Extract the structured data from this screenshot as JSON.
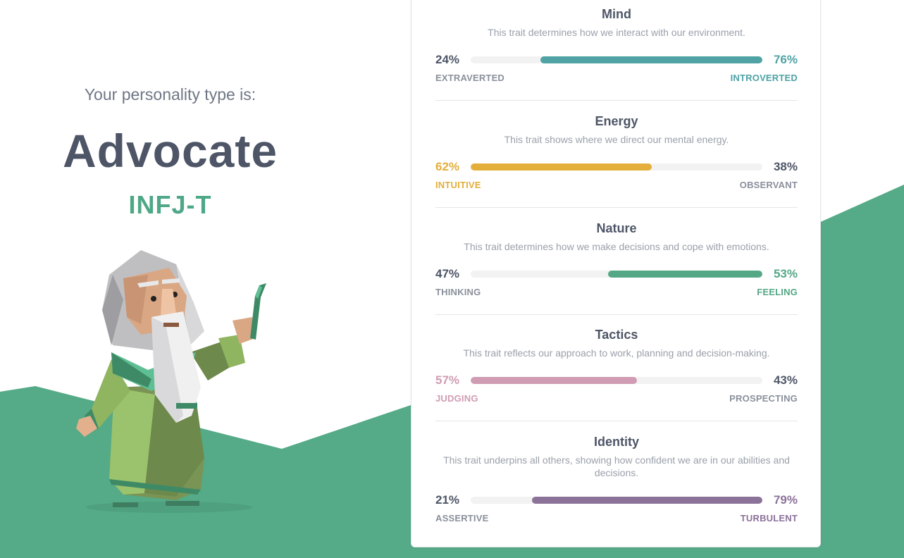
{
  "colors": {
    "background_wave": "#55aa87",
    "text_dark": "#4d5566",
    "text_muted": "#9aa0aa",
    "type_code": "#4ea887",
    "track": "#f2f2f3"
  },
  "profile": {
    "intro": "Your personality type is:",
    "type_name": "Advocate",
    "type_code": "INFJ-T",
    "avatar_icon": "advocate-wizard-illustration"
  },
  "traits": [
    {
      "title": "Mind",
      "description": "This trait determines how we interact with our environment.",
      "left_label": "EXTRAVERTED",
      "right_label": "INTROVERTED",
      "left_pct": "24%",
      "right_pct": "76%",
      "dominant": "right",
      "dominant_value": 76,
      "color": "#4fa3a5"
    },
    {
      "title": "Energy",
      "description": "This trait shows where we direct our mental energy.",
      "left_label": "INTUITIVE",
      "right_label": "OBSERVANT",
      "left_pct": "62%",
      "right_pct": "38%",
      "dominant": "left",
      "dominant_value": 62,
      "color": "#e4ae3a"
    },
    {
      "title": "Nature",
      "description": "This trait determines how we make decisions and cope with emotions.",
      "left_label": "THINKING",
      "right_label": "FEELING",
      "left_pct": "47%",
      "right_pct": "53%",
      "dominant": "right",
      "dominant_value": 53,
      "color": "#55a886"
    },
    {
      "title": "Tactics",
      "description": "This trait reflects our approach to work, planning and decision-making.",
      "left_label": "JUDGING",
      "right_label": "PROSPECTING",
      "left_pct": "57%",
      "right_pct": "43%",
      "dominant": "left",
      "dominant_value": 57,
      "color": "#d09cb3"
    },
    {
      "title": "Identity",
      "description": "This trait underpins all others, showing how confident we are in our abilities and decisions.",
      "left_label": "ASSERTIVE",
      "right_label": "TURBULENT",
      "left_pct": "21%",
      "right_pct": "79%",
      "dominant": "right",
      "dominant_value": 79,
      "color": "#8b7299"
    }
  ]
}
